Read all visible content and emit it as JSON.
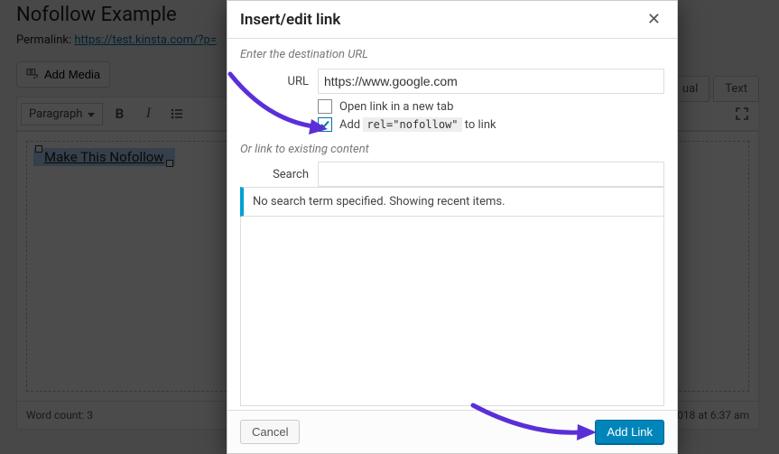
{
  "editor": {
    "title": "Nofollow Example",
    "permalink_label": "Permalink: ",
    "permalink_url": "https://test.kinsta.com/?p=",
    "add_media": "Add Media",
    "tab_visual": "ual",
    "tab_text": "Text",
    "format_select": "Paragraph",
    "selected_text": "Make This Nofollow",
    "word_count_label": "Word count: ",
    "word_count": "3",
    "last_edit": "018 at 6:37 am"
  },
  "modal": {
    "title": "Insert/edit link",
    "hint_dest": "Enter the destination URL",
    "url_label": "URL",
    "url_value": "https://www.google.com",
    "new_tab_label": "Open link in a new tab",
    "nofollow_pre": "Add ",
    "nofollow_code": "rel=\"nofollow\"",
    "nofollow_post": " to link",
    "hint_existing": "Or link to existing content",
    "search_label": "Search",
    "search_value": "",
    "notice": "No search term specified. Showing recent items.",
    "cancel": "Cancel",
    "submit": "Add Link"
  },
  "icons": {
    "media": "camera-music-icon",
    "bold": "B",
    "italic": "I",
    "list": "list-icon",
    "expand": "expand-icon",
    "close": "✕"
  }
}
